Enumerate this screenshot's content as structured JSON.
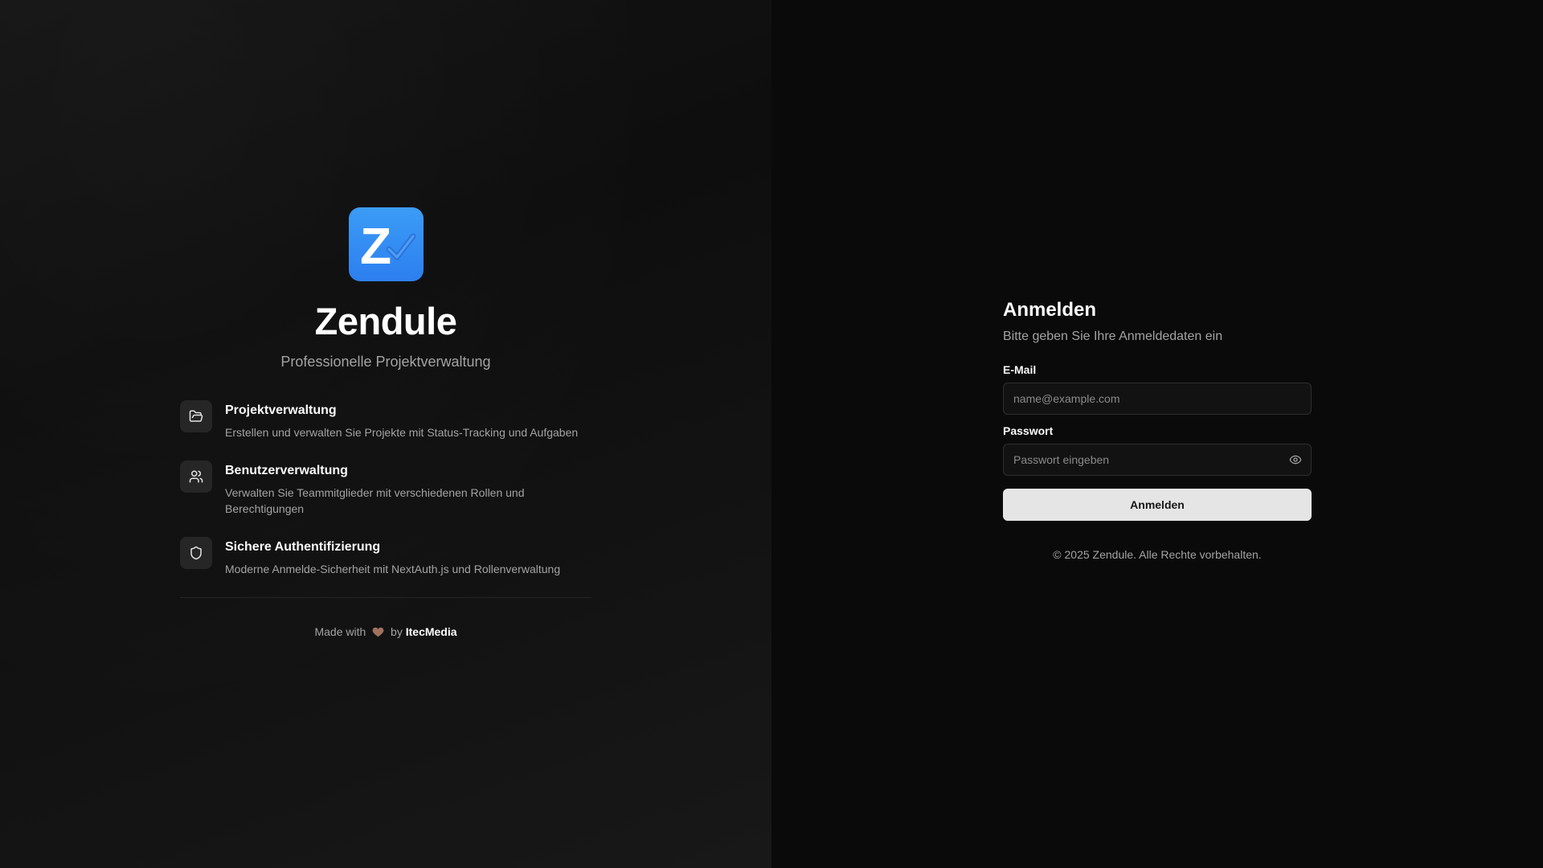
{
  "brand": {
    "logo_letter": "Z",
    "name": "Zendule",
    "tagline": "Professionelle Projektverwaltung",
    "logo_color": "#2d87f3"
  },
  "features": [
    {
      "icon": "folder-open-icon",
      "title": "Projektverwaltung",
      "description": "Erstellen und verwalten Sie Projekte mit Status-Tracking und Aufgaben"
    },
    {
      "icon": "users-icon",
      "title": "Benutzerverwaltung",
      "description": "Verwalten Sie Teammitglieder mit verschiedenen Rollen und Berechtigungen"
    },
    {
      "icon": "shield-icon",
      "title": "Sichere Authentifizierung",
      "description": "Moderne Anmelde-Sicherheit mit NextAuth.js und Rollenverwaltung"
    }
  ],
  "footer_left": {
    "made_with": "Made with",
    "by": "by",
    "company": "ItecMedia",
    "heart_color": "#a0715f"
  },
  "login": {
    "title": "Anmelden",
    "subtitle": "Bitte geben Sie Ihre Anmeldedaten ein",
    "email_label": "E-Mail",
    "email_placeholder": "name@example.com",
    "email_value": "",
    "password_label": "Passwort",
    "password_placeholder": "Passwort eingeben",
    "password_value": "",
    "submit_label": "Anmelden",
    "copyright": "© 2025 Zendule. Alle Rechte vorbehalten."
  }
}
